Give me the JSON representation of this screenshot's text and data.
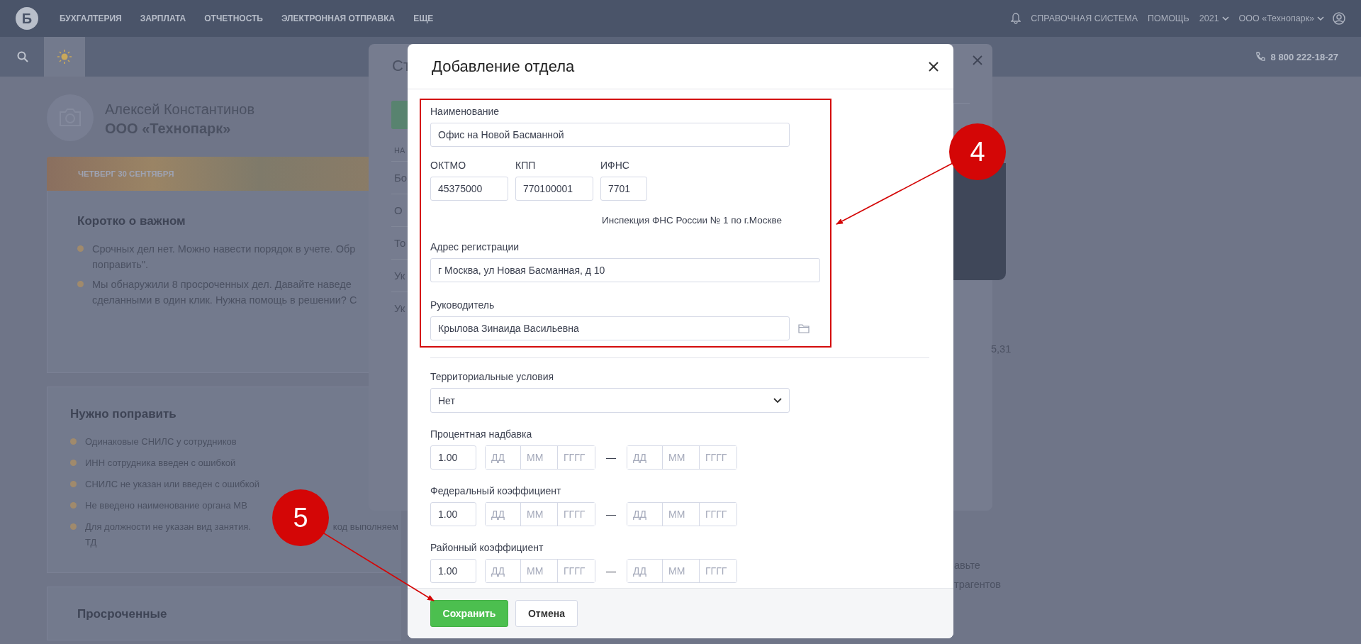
{
  "header": {
    "logo": "Б",
    "menu": [
      "БУХГАЛТЕРИЯ",
      "ЗАРПЛАТА",
      "ОТЧЕТНОСТЬ",
      "ЭЛЕКТРОННАЯ ОТПРАВКА",
      "ЕЩЕ"
    ],
    "links": [
      "СПРАВОЧНАЯ СИСТЕМА",
      "ПОМОЩЬ"
    ],
    "year": "2021",
    "org": "ООО «Технопарк»"
  },
  "toolbar": {
    "phone": "8 800 222-18-27"
  },
  "profile": {
    "name": "Алексей Константинов",
    "org": "ООО «Технопарк»"
  },
  "date_banner": "ЧЕТВЕРГ 30 СЕНТЯБРЯ",
  "cards": [
    {
      "title": "Коротко о важном",
      "items": [
        {
          "lines": [
            "Срочных дел нет. Можно навести порядок в учете. Обр",
            "поправить\"."
          ]
        },
        {
          "lines": [
            "Мы обнаружили 8 просроченных дел. Давайте наведе",
            "сделанными в один клик. Нужна помощь в решении? С"
          ]
        }
      ]
    },
    {
      "title": "Нужно поправить",
      "items": [
        {
          "lines": [
            "Одинаковые СНИЛС у сотрудников"
          ]
        },
        {
          "lines": [
            "ИНН сотрудника введен с ошибкой"
          ]
        },
        {
          "lines": [
            "СНИЛС не указан или введен с ошибкой"
          ]
        },
        {
          "lines": [
            "Не введено наименование органа МВ"
          ]
        },
        {
          "lines": [
            "Для должности не указан вид занятия.",
            "ТД"
          ],
          "tail": "код выполняем"
        }
      ]
    },
    {
      "title": "Просроченные"
    }
  ],
  "back_dialog": {
    "title": "Ст",
    "column_1": "НА",
    "rows": [
      "Бо",
      "О",
      "То",
      "Ук",
      "Ук"
    ]
  },
  "right_column": {
    "value": "5,31",
    "texts": [
      "авьте",
      "трагентов"
    ]
  },
  "dialog": {
    "title": "Добавление отдела",
    "name": {
      "label": "Наименование",
      "value": "Офис на Новой Басманной"
    },
    "codes": [
      {
        "label": "ОКТМО",
        "value": "45375000"
      },
      {
        "label": "КПП",
        "value": "770100001"
      },
      {
        "label": "ИФНС",
        "value": "7701"
      }
    ],
    "inspection": "Инспекция ФНС России № 1 по г.Москве",
    "address": {
      "label": "Адрес регистрации",
      "value": "г Москва, ул Новая Басманная, д 10"
    },
    "head": {
      "label": "Руководитель",
      "value": "Крылова Зинаида Васильевна"
    },
    "territory": {
      "label": "Территориальные условия",
      "value": "Нет"
    },
    "coefficients": [
      {
        "label": "Процентная надбавка",
        "value": "1.00",
        "separator": "—",
        "from": [
          {
            "placeholder": "ДД"
          },
          {
            "placeholder": "ММ"
          },
          {
            "placeholder": "ГГГГ"
          }
        ],
        "to": [
          {
            "placeholder": "ДД"
          },
          {
            "placeholder": "ММ"
          },
          {
            "placeholder": "ГГГГ"
          }
        ]
      },
      {
        "label": "Федеральный коэффициент",
        "value": "1.00",
        "separator": "—",
        "from": [
          {
            "placeholder": "ДД"
          },
          {
            "placeholder": "ММ"
          },
          {
            "placeholder": "ГГГГ"
          }
        ],
        "to": [
          {
            "placeholder": "ДД"
          },
          {
            "placeholder": "ММ"
          },
          {
            "placeholder": "ГГГГ"
          }
        ]
      },
      {
        "label": "Районный коэффициент",
        "value": "1.00",
        "separator": "—",
        "from": [
          {
            "placeholder": "ДД"
          },
          {
            "placeholder": "ММ"
          },
          {
            "placeholder": "ГГГГ"
          }
        ],
        "to": [
          {
            "placeholder": "ДД"
          },
          {
            "placeholder": "ММ"
          },
          {
            "placeholder": "ГГГГ"
          }
        ]
      }
    ],
    "buttons": [
      {
        "label": "Сохранить",
        "kind": "primary"
      },
      {
        "label": "Отмена",
        "kind": "secondary"
      }
    ]
  },
  "annotations": [
    {
      "number": "4"
    },
    {
      "number": "5"
    }
  ]
}
